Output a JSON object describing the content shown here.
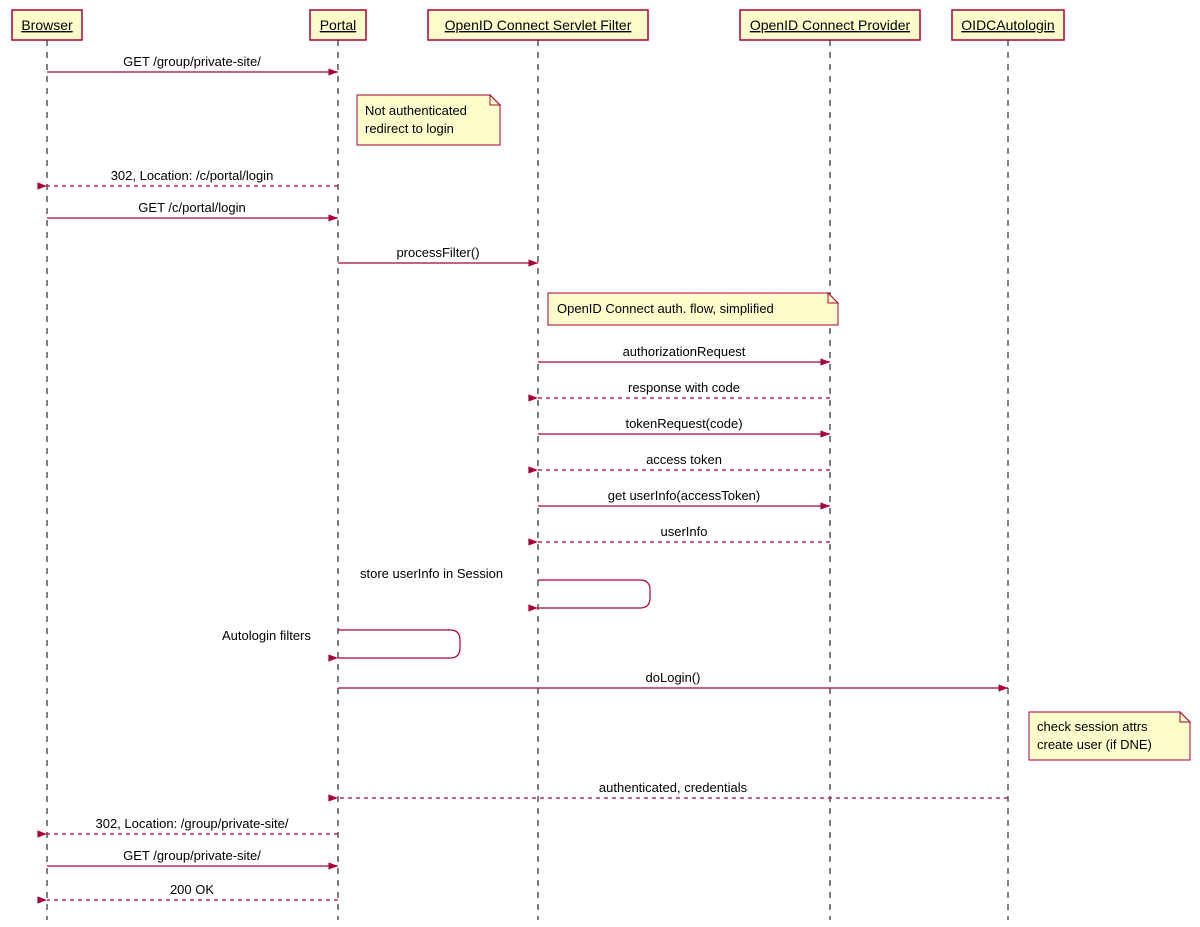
{
  "participants": {
    "browser": "Browser",
    "portal": "Portal",
    "filter": "OpenID Connect Servlet Filter",
    "provider": "OpenID Connect Provider",
    "autologin": "OIDCAutologin"
  },
  "messages": {
    "m1": "GET /group/private-site/",
    "m2": "302, Location: /c/portal/login",
    "m3": "GET /c/portal/login",
    "m4": "processFilter()",
    "m5": "authorizationRequest",
    "m6": "response with code",
    "m7": "tokenRequest(code)",
    "m8": "access token",
    "m9": "get userInfo(accessToken)",
    "m10": "userInfo",
    "m11": "store userInfo in Session",
    "m12": "Autologin filters",
    "m13": "doLogin()",
    "m14": "authenticated, credentials",
    "m15": "302, Location: /group/private-site/",
    "m16": "GET /group/private-site/",
    "m17": "200 OK"
  },
  "notes": {
    "n1a": "Not authenticated",
    "n1b": "redirect to login",
    "n2": "OpenID Connect auth. flow, simplified",
    "n3a": "check session attrs",
    "n3b": "create user (if DNE)"
  }
}
